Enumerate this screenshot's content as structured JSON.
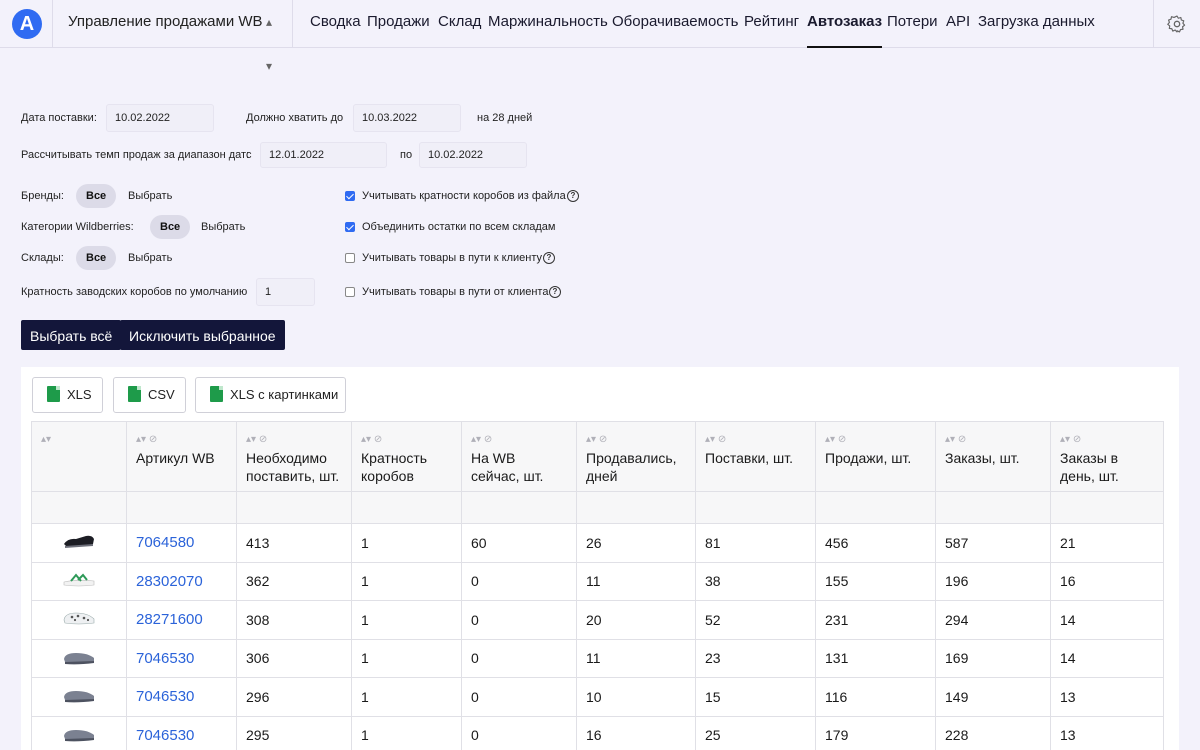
{
  "brand": {
    "logo_letter": "A",
    "app_name": "Управление продажами WB",
    "accent": "#2f6bf2"
  },
  "nav": {
    "items": [
      "Сводка",
      "Продажи",
      "Склад",
      "Маржинальность",
      "Оборачиваемость",
      "Рейтинг",
      "Автозаказ",
      "Потери",
      "API",
      "Загрузка данных"
    ],
    "active": "Автозаказ"
  },
  "form": {
    "delivery_date_label": "Дата поставки:",
    "delivery_date": "10.02.2022",
    "enough_until_label": "Должно хватить до",
    "enough_until": "10.03.2022",
    "days_note": "на 28 дней",
    "range_label": "Рассчитывать темп продаж за диапазон дат:",
    "from_label": "с",
    "date_from": "12.01.2022",
    "to_label": "по",
    "date_to": "10.02.2022",
    "brands_label": "Бренды:",
    "categories_label": "Категории Wildberries:",
    "warehouses_label": "Склады:",
    "all_label": "Все",
    "choose_label": "Выбрать",
    "box_multiplicity_label": "Кратность заводских коробов по умолчанию",
    "box_multiplicity": "1",
    "options": [
      {
        "label": "Учитывать кратности коробов из файла",
        "checked": true,
        "help": true
      },
      {
        "label": "Объединить остатки по всем складам",
        "checked": true,
        "help": false
      },
      {
        "label": "Учитывать товары в пути к клиенту",
        "checked": false,
        "help": true
      },
      {
        "label": "Учитывать товары в пути от клиента",
        "checked": false,
        "help": true
      }
    ],
    "select_all_button": "Выбрать всё",
    "exclude_button": "Исключить выбранное"
  },
  "export": {
    "xls": "XLS",
    "csv": "CSV",
    "xls_images": "XLS с картинками"
  },
  "table": {
    "columns": [
      "",
      "Артикул WB",
      "Необходимо поставить, шт.",
      "Кратность коробов",
      "На WB сейчас, шт.",
      "Продавались, дней",
      "Поставки, шт.",
      "Продажи, шт.",
      "Заказы, шт.",
      "Заказы в день, шт."
    ],
    "rows": [
      {
        "image": "black-sandal",
        "article": "7064580",
        "need": "413",
        "box": "1",
        "on_wb": "60",
        "days": "26",
        "supplies": "81",
        "sales": "456",
        "orders": "587",
        "per_day": "21"
      },
      {
        "image": "white-green-slide",
        "article": "28302070",
        "need": "362",
        "box": "1",
        "on_wb": "0",
        "days": "11",
        "supplies": "38",
        "sales": "155",
        "orders": "196",
        "per_day": "16"
      },
      {
        "image": "patterned-clog",
        "article": "28271600",
        "need": "308",
        "box": "1",
        "on_wb": "0",
        "days": "20",
        "supplies": "52",
        "sales": "231",
        "orders": "294",
        "per_day": "14"
      },
      {
        "image": "grey-clog",
        "article": "7046530",
        "need": "306",
        "box": "1",
        "on_wb": "0",
        "days": "11",
        "supplies": "23",
        "sales": "131",
        "orders": "169",
        "per_day": "14"
      },
      {
        "image": "grey-clog",
        "article": "7046530",
        "need": "296",
        "box": "1",
        "on_wb": "0",
        "days": "10",
        "supplies": "15",
        "sales": "116",
        "orders": "149",
        "per_day": "13"
      },
      {
        "image": "grey-clog",
        "article": "7046530",
        "need": "295",
        "box": "1",
        "on_wb": "0",
        "days": "16",
        "supplies": "25",
        "sales": "179",
        "orders": "228",
        "per_day": "13"
      }
    ]
  }
}
